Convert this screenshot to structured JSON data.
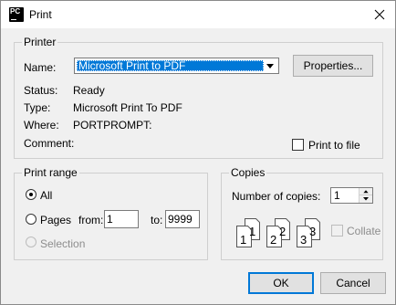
{
  "window": {
    "title": "Print",
    "app_icon": "pycharm-icon"
  },
  "printer": {
    "group_label": "Printer",
    "name_label": "Name:",
    "name_value": "Microsoft Print to PDF",
    "properties_button": "Properties...",
    "status_label": "Status:",
    "status_value": "Ready",
    "type_label": "Type:",
    "type_value": "Microsoft Print To PDF",
    "where_label": "Where:",
    "where_value": "PORTPROMPT:",
    "comment_label": "Comment:",
    "print_to_file_label": "Print to file",
    "print_to_file_checked": false
  },
  "print_range": {
    "group_label": "Print range",
    "all_label": "All",
    "pages_label": "Pages",
    "from_label": "from:",
    "from_value": "1",
    "to_label": "to:",
    "to_value": "9999",
    "selection_label": "Selection",
    "selected": "All"
  },
  "copies": {
    "group_label": "Copies",
    "number_label": "Number of copies:",
    "number_value": "1",
    "collate_label": "Collate",
    "collate_checked": false,
    "page_digits": [
      "1",
      "1",
      "2",
      "2",
      "3",
      "3"
    ]
  },
  "buttons": {
    "ok": "OK",
    "cancel": "Cancel"
  },
  "colors": {
    "selection": "#0078d7",
    "dialog_bg": "#f0f0f0",
    "disabled_text": "#8d8d8d"
  }
}
